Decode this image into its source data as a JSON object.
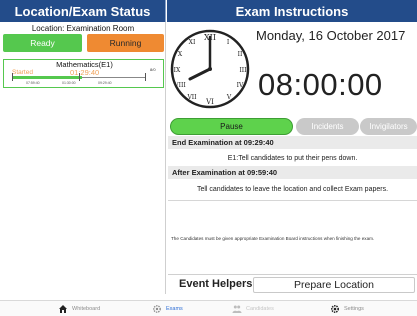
{
  "left_header": "Location/Exam Status",
  "right_header": "Exam Instructions",
  "location_label": "Location: Examination Room",
  "status_buttons": {
    "ready": "Ready",
    "running": "Running"
  },
  "exam": {
    "title": "Mathematics(E1)",
    "started_label": "Started",
    "time": "01:29:40",
    "end_marker": "8/0",
    "tick_labels": [
      "07:59:40",
      "01:30:00",
      "09:29:40"
    ],
    "progress": 0.52,
    "colors": {
      "status": "#55c84e",
      "time": "#f0a25a"
    }
  },
  "date": "Monday, 16 October 2017",
  "current_time": "08:00:00",
  "tabs": {
    "pause": "Pause",
    "incidents": "Incidents",
    "invigilators": "Invigilators"
  },
  "instructions": [
    {
      "heading": "End Examination at 09:29:40",
      "text": "E1:Tell candidates to put their pens down."
    },
    {
      "heading": "After Examination at 09:59:40",
      "text": "Tell candidates to leave the location and collect Exam papers."
    }
  ],
  "note": "The Candidates must be given appropriate Examination Board instructions when finishing the exam.",
  "event_helpers_label": "Event Helpers",
  "prepare_location_label": "Prepare Location",
  "nav": {
    "whiteboard": "Whiteboard",
    "exams": "Exams",
    "candidates": "Candidates",
    "settings": "Settings"
  },
  "colors": {
    "header": "#234c8a",
    "accent": "#2f6fd6",
    "ready": "#55c84e",
    "running": "#ef8a32"
  },
  "icons": {
    "whiteboard": "home-icon",
    "exams": "gear-icon",
    "candidates": "people-icon",
    "settings": "gear-icon"
  }
}
